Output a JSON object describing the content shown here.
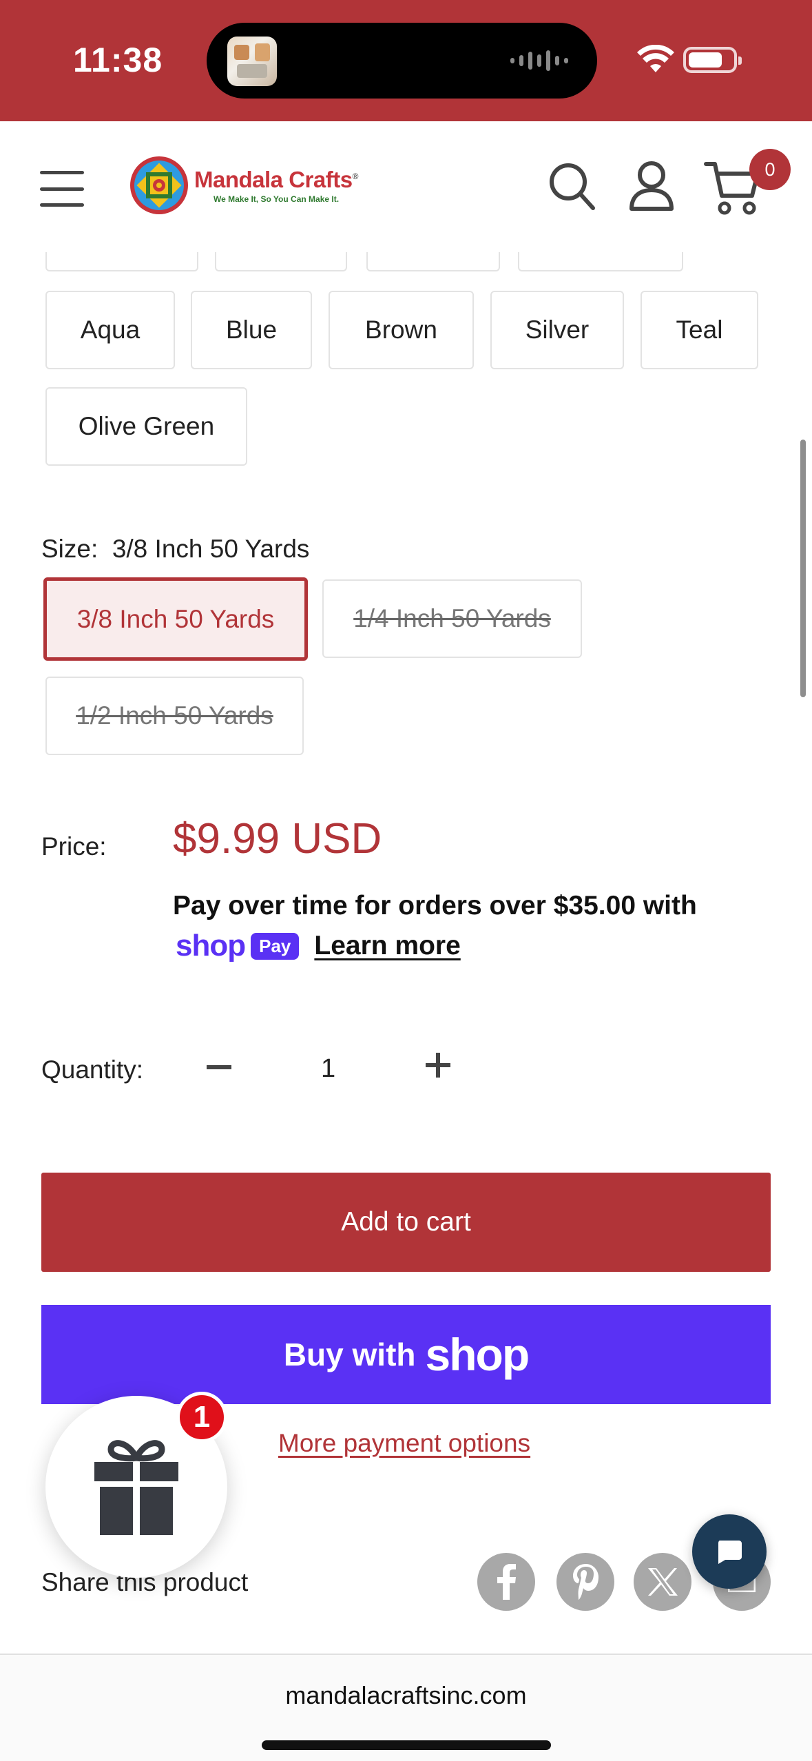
{
  "status_bar": {
    "time": "11:38"
  },
  "header": {
    "logo_title": "Mandala Crafts",
    "logo_registered": "®",
    "logo_tagline": "We Make It, So You Can Make It.",
    "cart_count": "0"
  },
  "colors": {
    "brand": "#b13438",
    "shop_pay": "#5a31f4",
    "chat": "#1c3b57",
    "gift_badge": "#e0101a"
  },
  "color_options": [
    "Aqua",
    "Blue",
    "Brown",
    "Silver",
    "Teal",
    "Olive Green"
  ],
  "size": {
    "label": "Size:",
    "selected_value": "3/8 Inch 50 Yards",
    "options": [
      {
        "label": "3/8 Inch 50 Yards",
        "state": "selected"
      },
      {
        "label": "1/4 Inch 50 Yards",
        "state": "unavailable"
      },
      {
        "label": "1/2 Inch 50 Yards",
        "state": "unavailable"
      }
    ]
  },
  "price": {
    "label": "Price:",
    "value": "$9.99 USD",
    "installments_text": "Pay over time for orders over $35.00 with",
    "shop_word": "shop",
    "pay_chip": "Pay",
    "learn_more": "Learn more"
  },
  "quantity": {
    "label": "Quantity:",
    "value": "1"
  },
  "actions": {
    "add_to_cart": "Add to cart",
    "buy_with": "Buy with",
    "buy_shop": "shop",
    "more_payment": "More payment options"
  },
  "share": {
    "label": "Share this product",
    "icons": [
      "facebook-icon",
      "pinterest-icon",
      "x-icon",
      "email-icon"
    ]
  },
  "gift_widget": {
    "badge_count": "1"
  },
  "browser": {
    "url": "mandalacraftsinc.com"
  }
}
